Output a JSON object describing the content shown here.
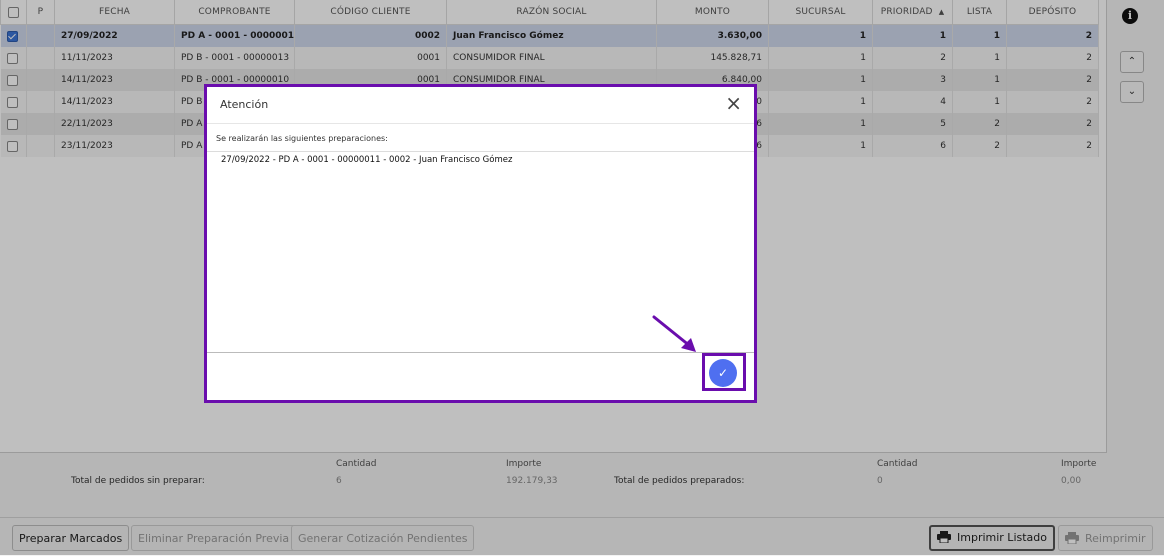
{
  "grid": {
    "columns": [
      "P",
      "FECHA",
      "COMPROBANTE",
      "CÓDIGO CLIENTE",
      "RAZÓN SOCIAL",
      "MONTO",
      "SUCURSAL",
      "PRIORIDAD",
      "LISTA",
      "DEPÓSITO"
    ],
    "rows": [
      {
        "checked": true,
        "fecha": "27/09/2022",
        "comprobante": "PD A - 0001 - 00000011",
        "codigo": "0002",
        "razon": "Juan Francisco Gómez",
        "monto": "3.630,00",
        "sucursal": "1",
        "prioridad": "1",
        "lista": "1",
        "deposito": "2"
      },
      {
        "checked": false,
        "fecha": "11/11/2023",
        "comprobante": "PD B - 0001 - 00000013",
        "codigo": "0001",
        "razon": "CONSUMIDOR FINAL",
        "monto": "145.828,71",
        "sucursal": "1",
        "prioridad": "2",
        "lista": "1",
        "deposito": "2"
      },
      {
        "checked": false,
        "fecha": "14/11/2023",
        "comprobante": "PD B - 0001 - 00000010",
        "codigo": "0001",
        "razon": "CONSUMIDOR FINAL",
        "monto": "6.840,00",
        "sucursal": "1",
        "prioridad": "3",
        "lista": "1",
        "deposito": "2"
      },
      {
        "checked": false,
        "fecha": "14/11/2023",
        "comprobante": "PD B",
        "codigo": "",
        "razon": "",
        "monto": "0",
        "sucursal": "1",
        "prioridad": "4",
        "lista": "1",
        "deposito": "2"
      },
      {
        "checked": false,
        "fecha": "22/11/2023",
        "comprobante": "PD A",
        "codigo": "",
        "razon": "",
        "monto": "6",
        "sucursal": "1",
        "prioridad": "5",
        "lista": "2",
        "deposito": "2"
      },
      {
        "checked": false,
        "fecha": "23/11/2023",
        "comprobante": "PD A",
        "codigo": "",
        "razon": "",
        "monto": "6",
        "sucursal": "1",
        "prioridad": "6",
        "lista": "2",
        "deposito": "2"
      }
    ]
  },
  "side": {
    "info": "i",
    "up": "⌃",
    "down": "⌄"
  },
  "totals": {
    "cantidad_label": "Cantidad",
    "importe_label": "Importe",
    "sin_preparar_label": "Total de pedidos sin preparar:",
    "sin_preparar_cantidad": "6",
    "sin_preparar_importe": "192.179,33",
    "preparados_label": "Total de pedidos preparados:",
    "preparados_cantidad": "0",
    "preparados_importe": "0,00"
  },
  "footer": {
    "preparar": "Preparar Marcados",
    "eliminar": "Eliminar Preparación Previa",
    "generar": "Generar Cotización Pendientes",
    "imprimir": "Imprimir Listado",
    "reimprimir": "Reimprimir"
  },
  "dialog": {
    "title": "Atención",
    "close": "×",
    "message": "Se realizarán las siguientes preparaciones:",
    "items": [
      "27/09/2022 - PD A - 0001 - 00000011 - 0002 - Juan Francisco Gómez"
    ],
    "confirm_icon": "✓"
  },
  "colors": {
    "highlight": "#6a0dad",
    "confirm": "#4f6ff0"
  }
}
